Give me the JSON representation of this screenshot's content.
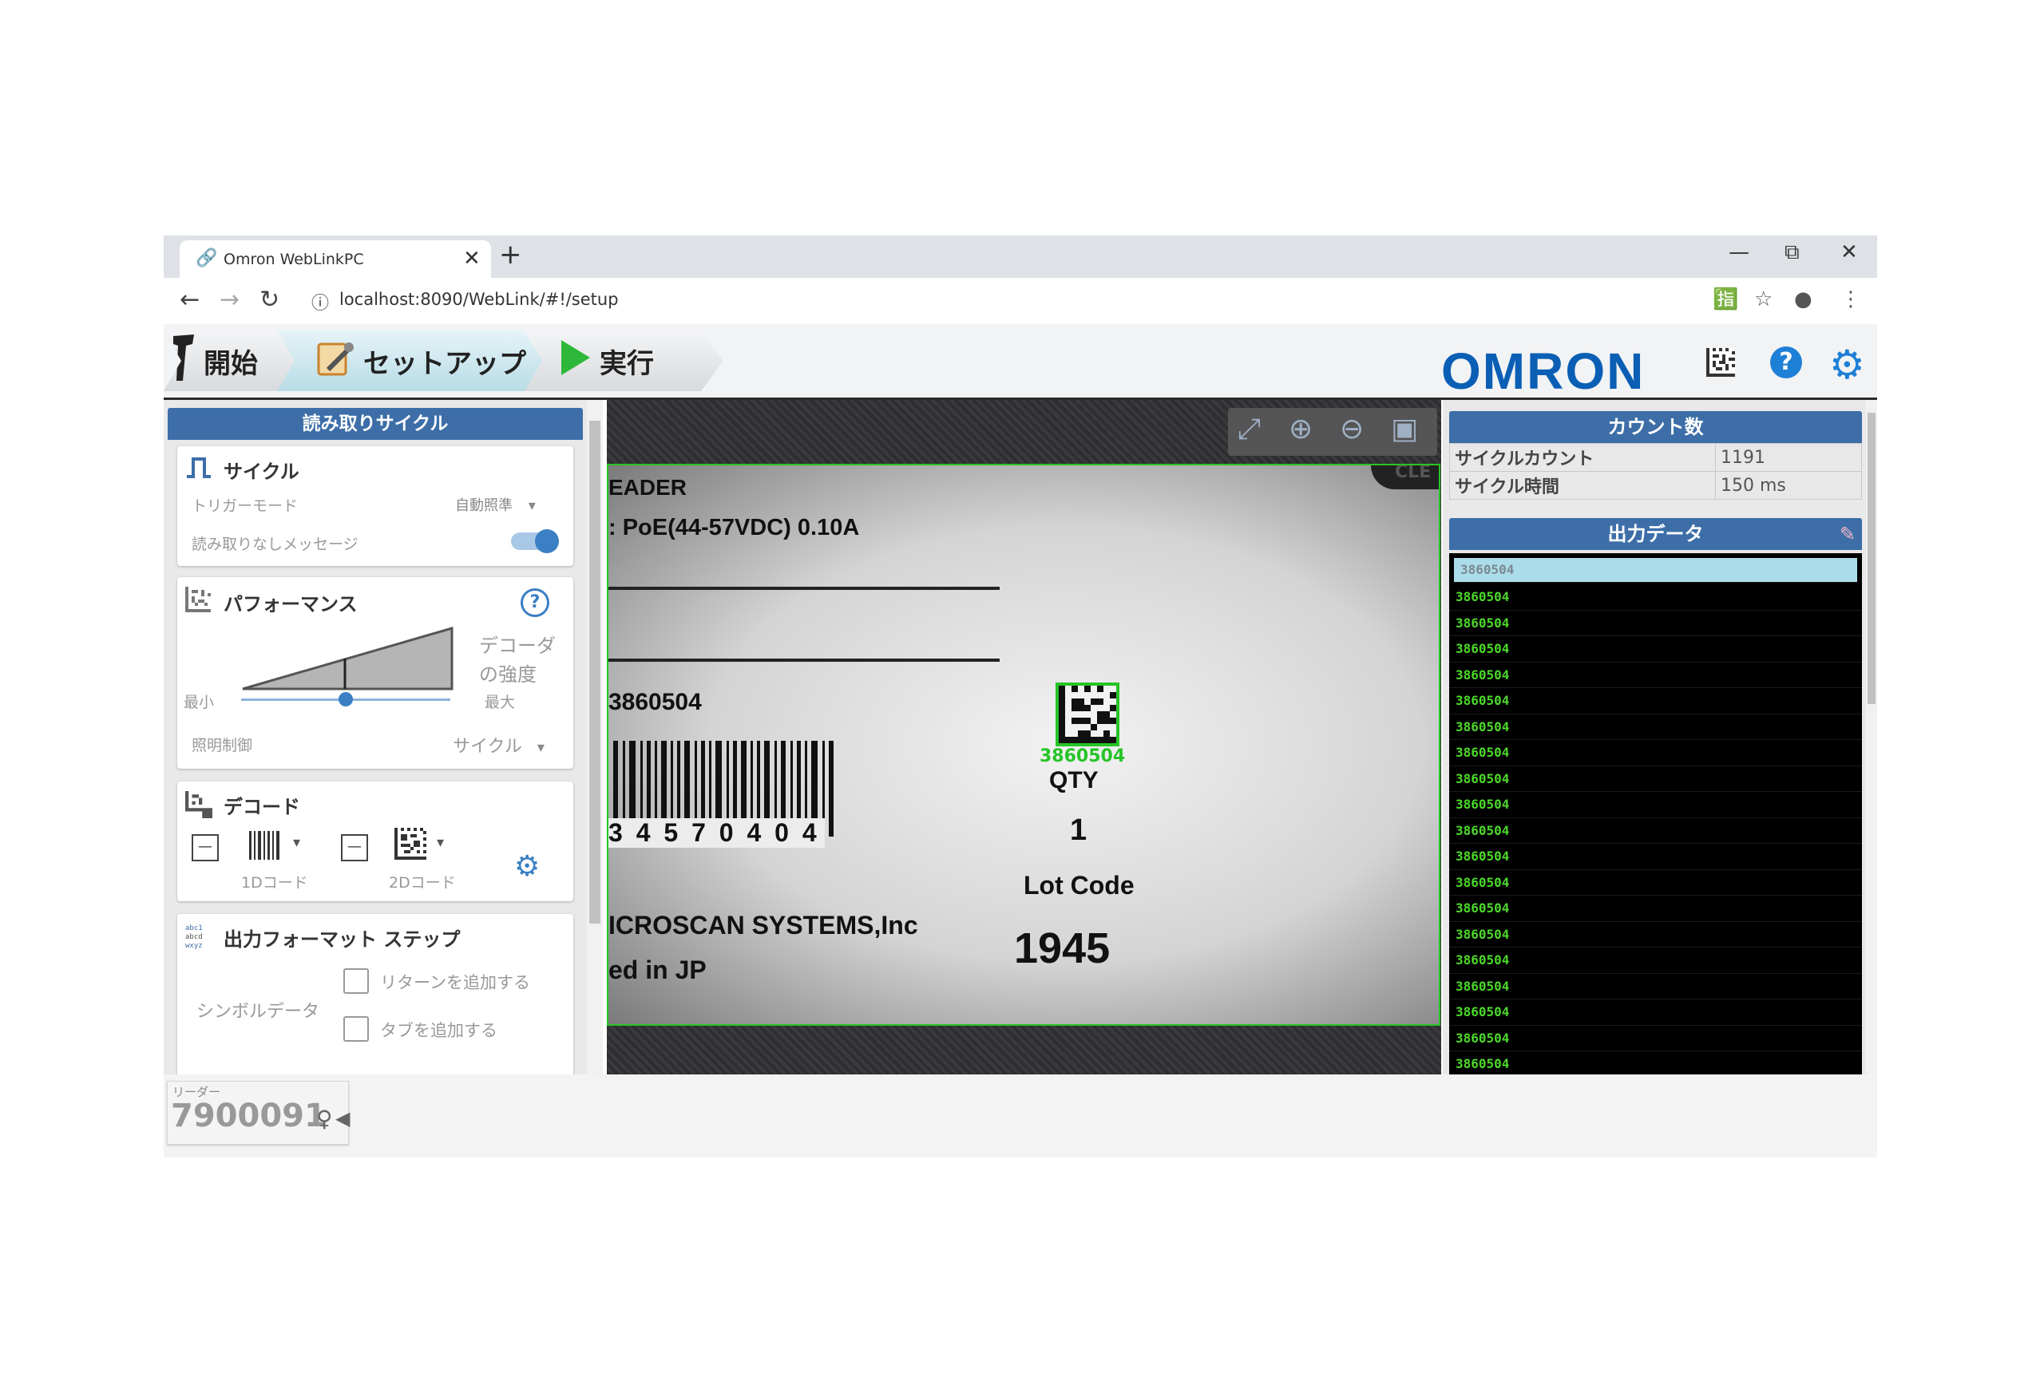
{
  "browser": {
    "tab_title": "Omron WebLinkPC",
    "tab_close": "✕",
    "new_tab": "+",
    "url": "localhost:8090/WebLink/#!/setup",
    "window_controls": {
      "minimize": "—",
      "restore": "⧉",
      "close": "✕"
    }
  },
  "header": {
    "steps": [
      {
        "label": "開始",
        "icon": "scanner-icon"
      },
      {
        "label": "セットアップ",
        "icon": "setup-icon",
        "active": true
      },
      {
        "label": "実行",
        "icon": "play-icon"
      }
    ],
    "logo": "OMRON",
    "help": "?"
  },
  "left_panel": {
    "title": "読み取りサイクル",
    "cycle": {
      "title": "サイクル",
      "trigger_mode_label": "トリガーモード",
      "trigger_mode_value": "自動照準",
      "no_read_label": "読み取りなしメッセージ",
      "no_read_enabled": true
    },
    "performance": {
      "title": "パフォーマンス",
      "decoder_strength_label_1": "デコーダ",
      "decoder_strength_label_2": "の強度",
      "min_label": "最小",
      "max_label": "最大",
      "slider_level": 0.5,
      "lighting_label": "照明制御",
      "lighting_value": "サイクル"
    },
    "decode": {
      "title": "デコード",
      "code_1d_label": "1Dコード",
      "code_2d_label": "2Dコード",
      "minus": "—"
    },
    "output_format": {
      "title": "出力フォーマット ステップ",
      "symbol_data_label": "シンボルデータ",
      "add_return_label": "リターンを追加する",
      "add_tab_label": "タブを追加する"
    }
  },
  "image_view": {
    "line_1": "EADER",
    "line_2": ": PoE(44-57VDC) 0.10A",
    "part_number": "3860504",
    "barcode_digits": "3 4 5 7 0 4 0 4",
    "decoded_overlay": "3860504",
    "qty_label": "QTY",
    "qty_value": "1",
    "lot_label": "Lot Code",
    "lot_value": "1945",
    "company": "ICROSCAN SYSTEMS,Inc",
    "made_in": "ed in JP",
    "corner_tag": "CLE"
  },
  "right_panel": {
    "count_title": "カウント数",
    "counts": [
      {
        "key": "サイクルカウント",
        "value": "1191"
      },
      {
        "key": "サイクル時間",
        "value": "150 ms"
      }
    ],
    "output_title": "出力データ",
    "output_rows": [
      "3860504",
      "3860504",
      "3860504",
      "3860504",
      "3860504",
      "3860504",
      "3860504",
      "3860504",
      "3860504",
      "3860504",
      "3860504",
      "3860504",
      "3860504",
      "3860504",
      "3860504",
      "3860504",
      "3860504",
      "3860504",
      "3860504",
      "3860504",
      "3860504"
    ]
  },
  "footer": {
    "reader_label": "リーダー",
    "reader_id": "7900091"
  }
}
